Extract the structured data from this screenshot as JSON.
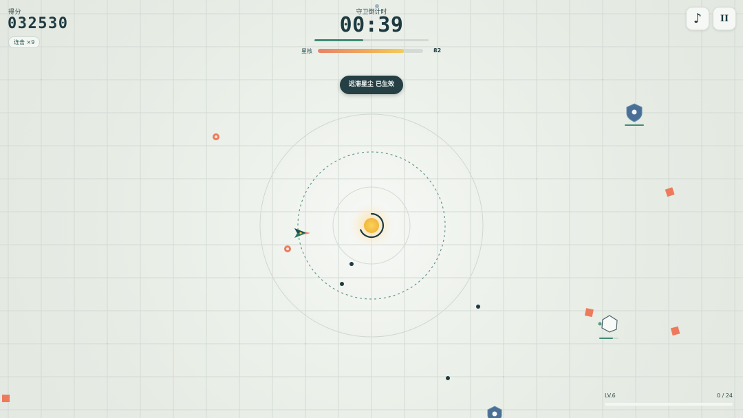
{
  "hud": {
    "score_label": "得分",
    "score_value": "032530",
    "combo_label": "连击 ×9",
    "timer_label": "守卫倒计时",
    "timer_value": "00:39",
    "timer_progress": 0.43,
    "core_label": "星核",
    "core_value": "82",
    "core_progress": 0.82,
    "toast_text": "迟滞星尘 已生效",
    "level_label": "LV.6",
    "level_count": "0 / 24",
    "level_progress": 0
  },
  "buttons": {
    "music_icon": "music-note-icon",
    "music_glyph": "♪",
    "pause_icon": "pause-icon",
    "pause_glyph": "II"
  },
  "colors": {
    "accent": "#3f8a77",
    "dark": "#1e3a40",
    "enemy_orange": "#ee7a5c",
    "core_yellow": "#f3c446",
    "shield_blue": "#4a6f96"
  }
}
